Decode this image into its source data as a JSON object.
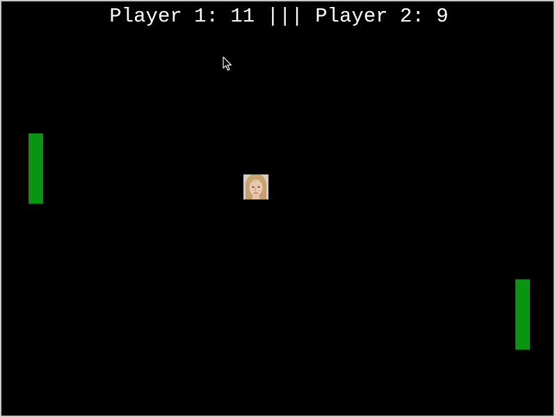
{
  "scoreboard": {
    "player1_label": "Player 1:",
    "player1_score": "11",
    "separator": "|||",
    "player2_label": "Player 2:",
    "player2_score": "9"
  },
  "colors": {
    "background": "#000000",
    "paddle": "#0a9412",
    "score_text": "#ffffff"
  },
  "sprites": {
    "ball": "face-ball-icon",
    "cursor": "mouse-pointer-icon"
  }
}
